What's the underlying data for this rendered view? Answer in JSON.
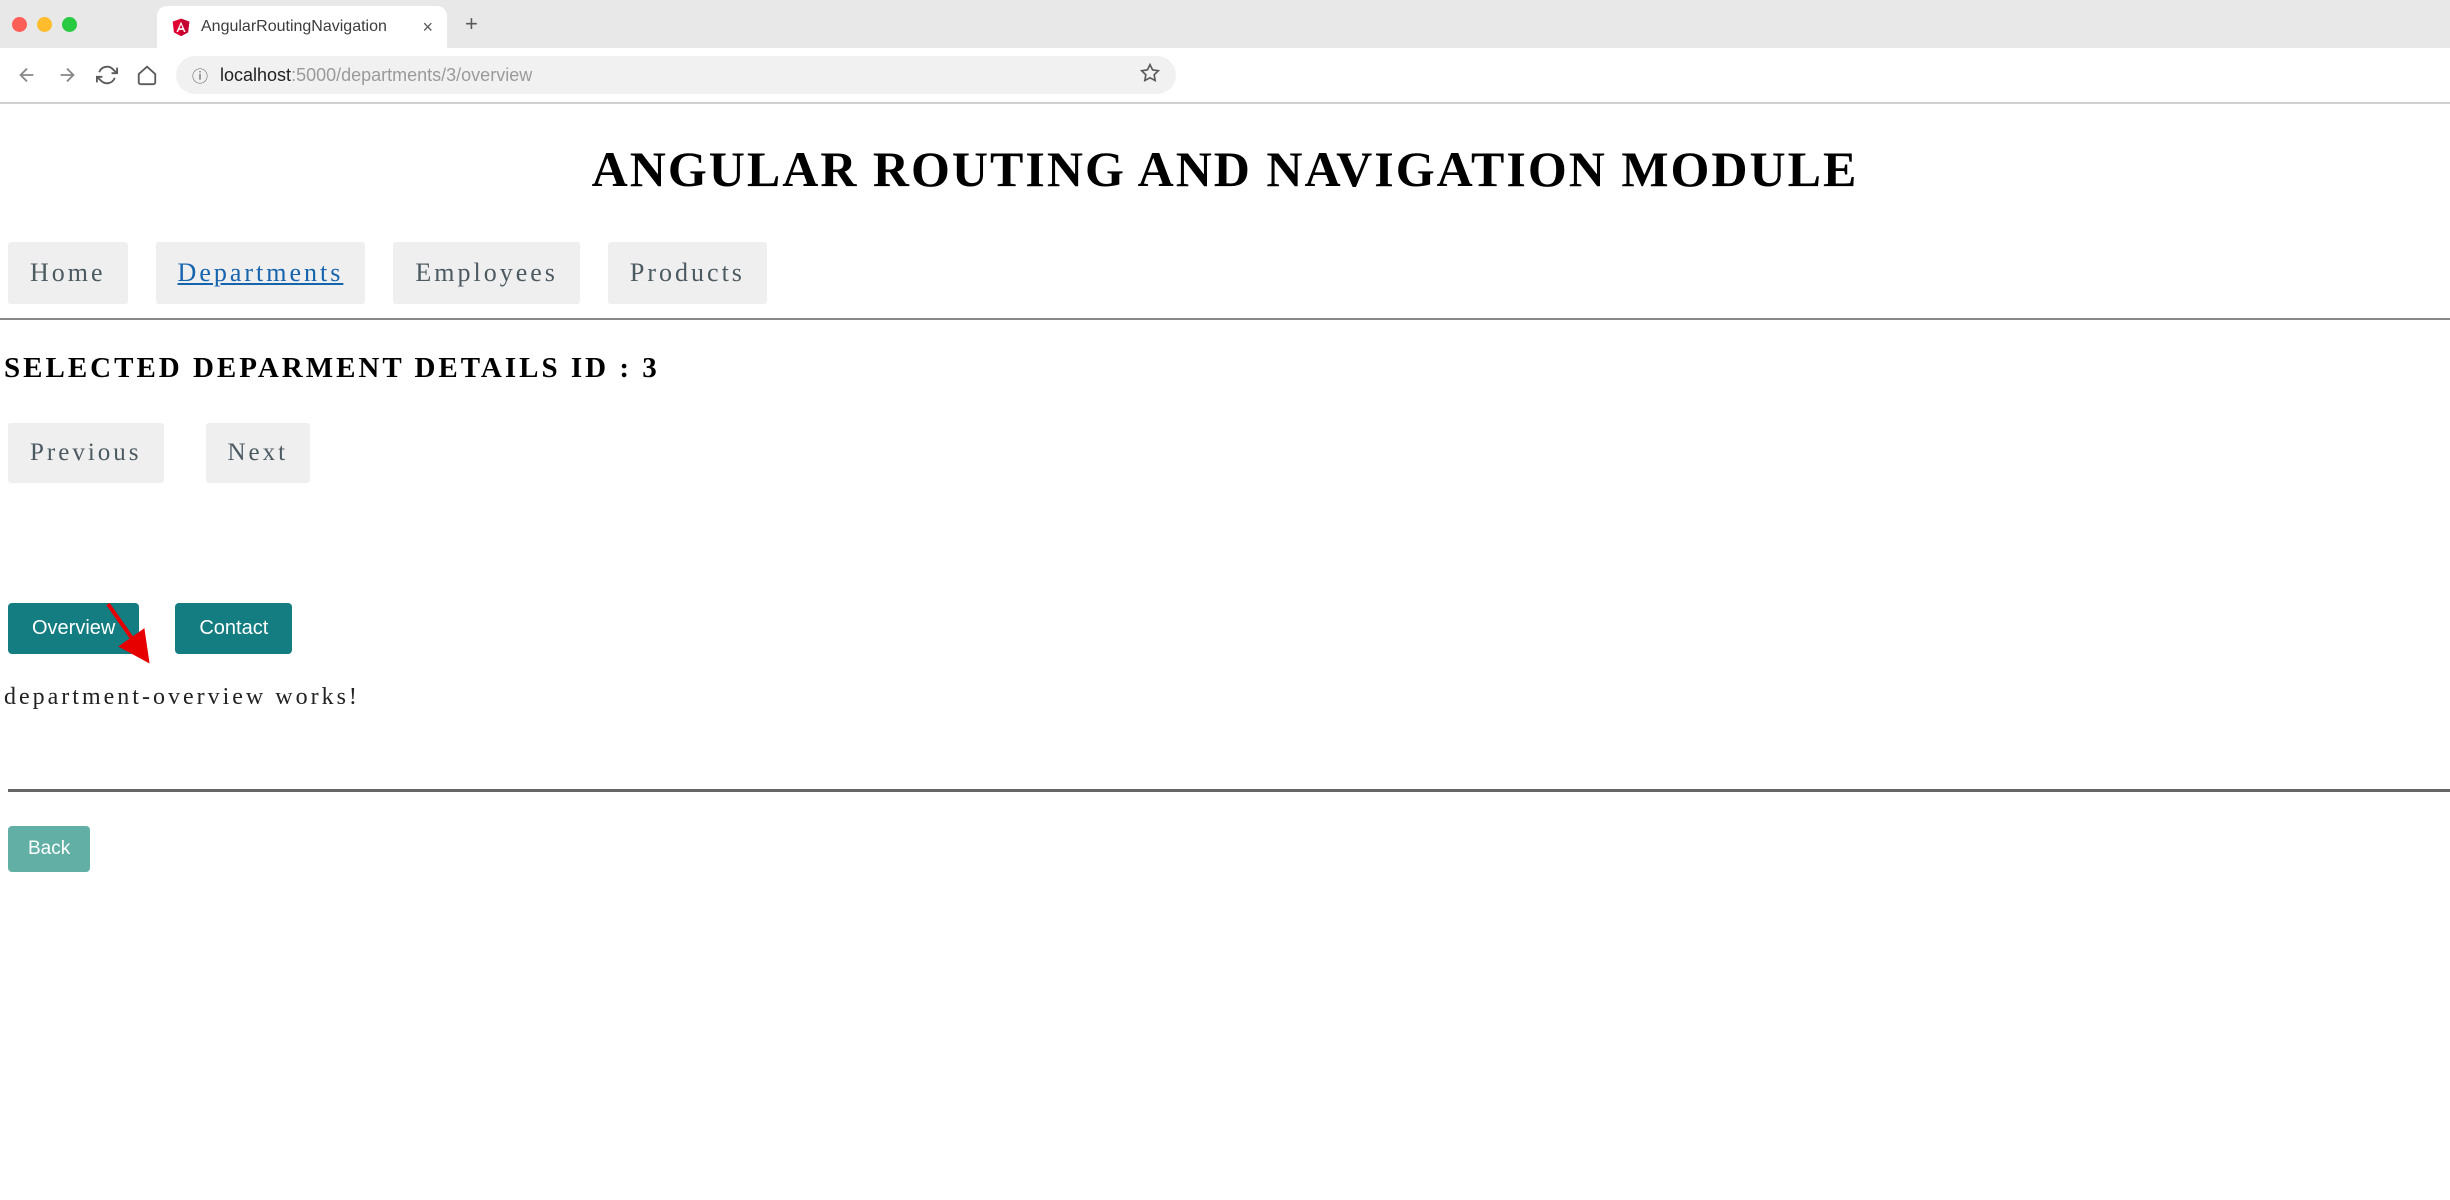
{
  "browser": {
    "tab_title": "AngularRoutingNavigation",
    "url_host": "localhost",
    "url_path": ":5000/departments/3/overview"
  },
  "page": {
    "title": "ANGULAR ROUTING AND NAVIGATION MODULE",
    "nav": [
      "Home",
      "Departments",
      "Employees",
      "Products"
    ],
    "nav_active_index": 1,
    "heading_prefix": "SELECTED DEPARMENT DETAILS ID : ",
    "heading_id": "3",
    "actions": {
      "prev": "Previous",
      "next": "Next"
    },
    "sub_tabs": {
      "overview": "Overview",
      "contact": "Contact"
    },
    "body_text": "department-overview works!",
    "back_label": "Back"
  }
}
